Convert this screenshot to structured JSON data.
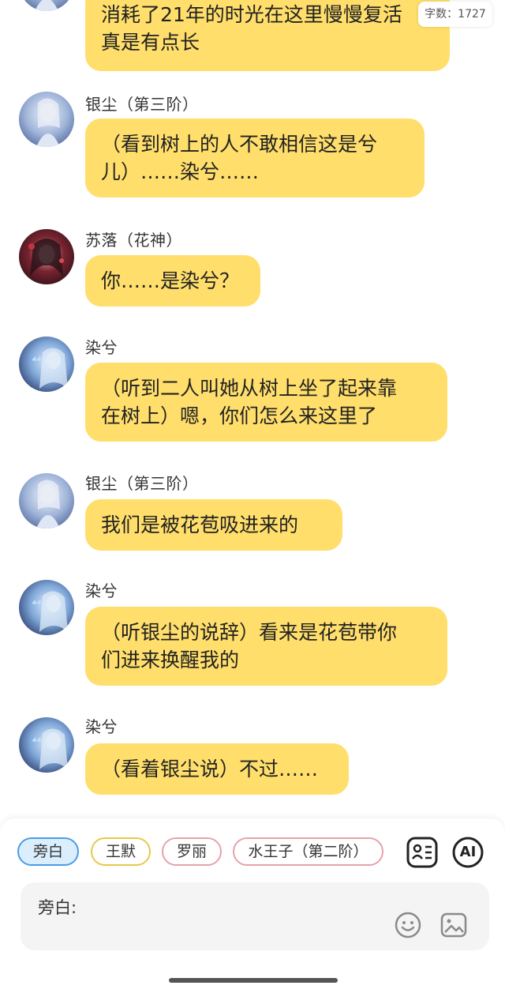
{
  "word_count": "字数：1727",
  "messages": [
    {
      "name": "",
      "avatar": "silver-robe-avatar",
      "text_lines": [
        "消耗了21年的时光在这里慢慢复活",
        "真是有点长"
      ]
    },
    {
      "name": "银尘（第三阶）",
      "avatar": "silver-robe-avatar",
      "text_lines": [
        "（看到树上的人不敢相信这是兮",
        "儿）……染兮……"
      ]
    },
    {
      "name": "苏落（花神）",
      "avatar": "dark-red-avatar",
      "text_lines": [
        "你……是染兮？"
      ]
    },
    {
      "name": "染兮",
      "avatar": "blue-butterfly-avatar",
      "text_lines": [
        "（听到二人叫她从树上坐了起来靠",
        "在树上）嗯，你们怎么来这里了"
      ]
    },
    {
      "name": "银尘（第三阶）",
      "avatar": "silver-robe-avatar",
      "text_lines": [
        "我们是被花苞吸进来的"
      ]
    },
    {
      "name": "染兮",
      "avatar": "blue-butterfly-avatar",
      "text_lines": [
        "（听银尘的说辞）看来是花苞带你",
        "们进来换醒我的"
      ]
    },
    {
      "name": "染兮",
      "avatar": "blue-butterfly-avatar",
      "text_lines": [
        "（看着银尘说）不过……"
      ]
    }
  ],
  "role_chips": [
    "旁白",
    "王默",
    "罗丽",
    "水王子（第二阶）"
  ],
  "ai_label": "AI",
  "input": {
    "label": "旁白:"
  },
  "icons": {
    "character_card": "character-card-icon",
    "ai": "ai-icon",
    "emoji": "emoji-icon",
    "image": "image-icon"
  },
  "colors": {
    "bubble": "#ffde6b",
    "chip_active_border": "#4a9de8",
    "chip_active_bg": "#dbeefe"
  }
}
